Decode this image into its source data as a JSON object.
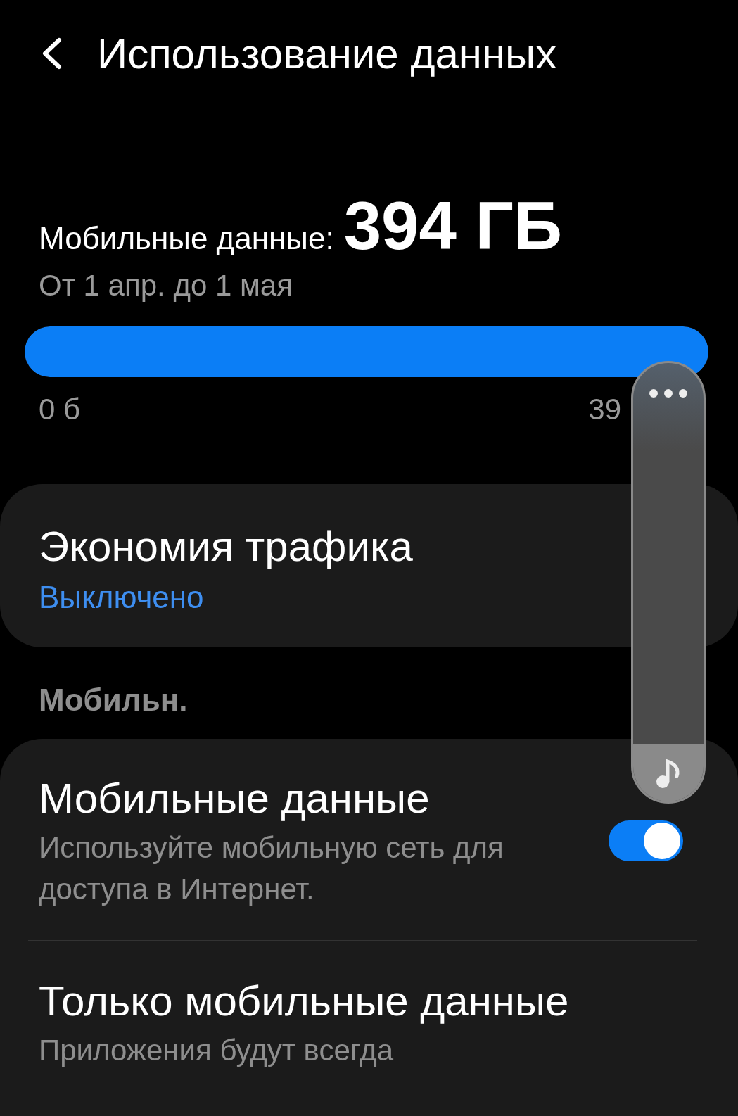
{
  "header": {
    "title": "Использование данных"
  },
  "usage": {
    "label": "Мобильные данные:",
    "amount": "394 ГБ",
    "period": "От 1 апр. до 1 мая",
    "level": 1,
    "min_label": "0 б",
    "max_label": "39"
  },
  "saver": {
    "title": "Экономия трафика",
    "status": "Выключено"
  },
  "section": {
    "title": "Мобильн."
  },
  "settings": [
    {
      "title": "Мобильные данные",
      "subtitle": "Используйте мобильную сеть для доступа в Интернет.",
      "kind": "toggle",
      "on": true
    },
    {
      "title": "Только мобильные данные",
      "subtitle": "Приложения будут всегда",
      "kind": "plain"
    }
  ],
  "volume_panel": {
    "level": 0.13
  }
}
